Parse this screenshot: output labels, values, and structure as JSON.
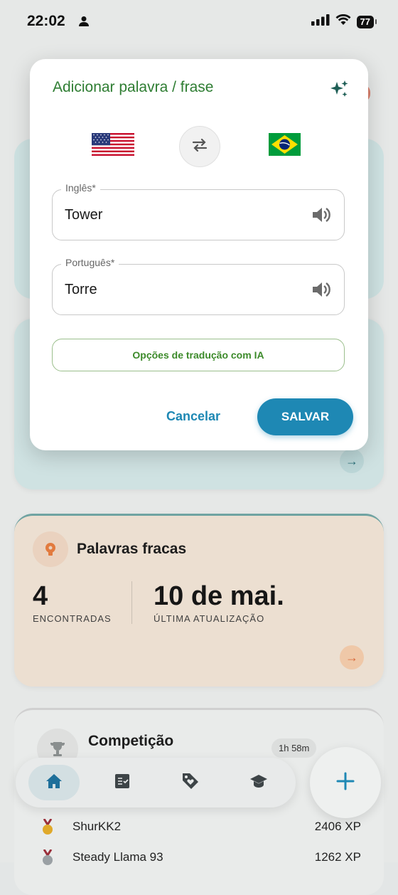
{
  "status_bar": {
    "time": "22:02",
    "battery": "77"
  },
  "dialog": {
    "title": "Adicionar palavra / frase",
    "source_field": {
      "label": "Inglês*",
      "value": "Tower"
    },
    "target_field": {
      "label": "Português*",
      "value": "Torre"
    },
    "ai_options_label": "Opções de tradução com IA",
    "cancel_label": "Cancelar",
    "save_label": "SALVAR"
  },
  "weak_words": {
    "title": "Palavras fracas",
    "found_count": "4",
    "found_label": "ENCONTRADAS",
    "last_update": "10 de mai.",
    "last_update_label": "ÚLTIMA ATUALIZAÇÃO"
  },
  "competition": {
    "title": "Competição",
    "timer": "1h 58m",
    "ranking": [
      {
        "name": "ShurKK2",
        "xp": "2406 XP",
        "medal": "gold"
      },
      {
        "name": "Steady Llama 93",
        "xp": "1262 XP",
        "medal": "silver"
      }
    ]
  },
  "bottom_nav": {
    "items": [
      {
        "icon": "home-icon",
        "active": true
      },
      {
        "icon": "checklist-icon",
        "active": false
      },
      {
        "icon": "tag-heart-icon",
        "active": false
      },
      {
        "icon": "graduation-cap-icon",
        "active": false
      }
    ],
    "fab_icon": "plus-icon"
  },
  "colors": {
    "primary": "#1e88b4",
    "title_green": "#2e7d32",
    "ai_green": "#3c8a2a"
  }
}
